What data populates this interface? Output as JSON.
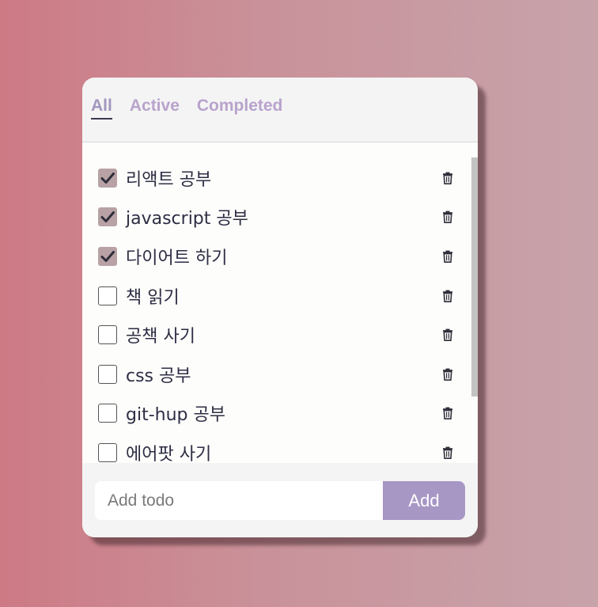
{
  "filters": [
    {
      "label": "All",
      "active": true
    },
    {
      "label": "Active",
      "active": false
    },
    {
      "label": "Completed",
      "active": false
    }
  ],
  "todos": [
    {
      "text": "리액트 공부",
      "completed": true
    },
    {
      "text": "javascript 공부",
      "completed": true
    },
    {
      "text": "다이어트 하기",
      "completed": true
    },
    {
      "text": "책 읽기",
      "completed": false
    },
    {
      "text": "공책 사기",
      "completed": false
    },
    {
      "text": "css 공부",
      "completed": false
    },
    {
      "text": "git-hup 공부",
      "completed": false
    },
    {
      "text": "에어팟 사기",
      "completed": false
    }
  ],
  "add_form": {
    "placeholder": "Add todo",
    "value": "",
    "button_label": "Add"
  },
  "colors": {
    "accent": "#a797c5",
    "tab_inactive": "#b8a3cc",
    "checkbox_checked": "#b8a2a6",
    "text": "#2d2d44"
  },
  "icons": {
    "delete": "trash-icon",
    "check": "check-icon"
  }
}
